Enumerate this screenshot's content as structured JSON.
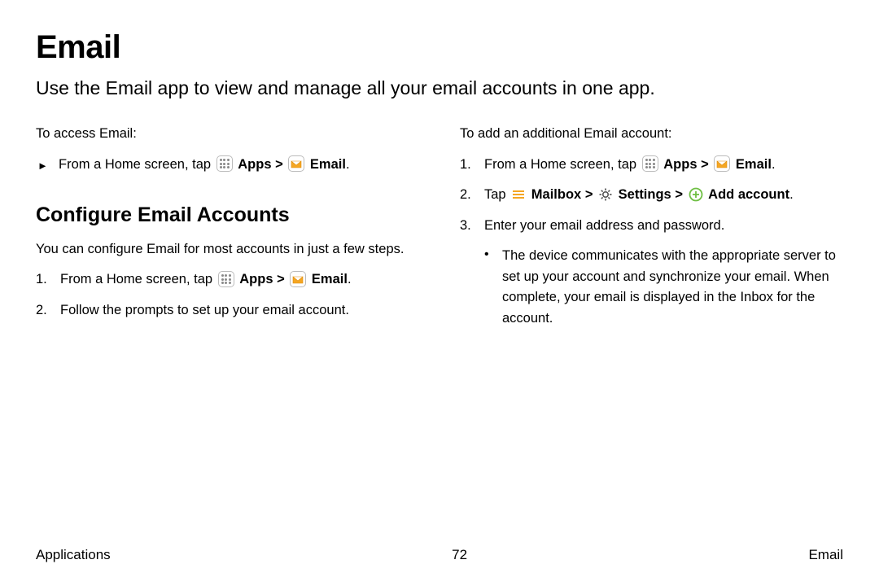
{
  "title": "Email",
  "intro": "Use the Email app to view and manage all your email accounts in one app.",
  "left": {
    "access_label": "To access Email:",
    "step1_prefix": "From a Home screen, tap ",
    "apps_label": "Apps",
    "chevron": ">",
    "email_label": "Email",
    "period": ".",
    "section_title": "Configure Email Accounts",
    "section_desc": "You can configure Email for most accounts in just a few steps.",
    "num1": "1.",
    "num2": "2.",
    "step_configure_1_prefix": "From a Home screen, tap ",
    "step_configure_2": "Follow the prompts to set up your email account."
  },
  "right": {
    "add_label": "To add an additional Email account:",
    "num1": "1.",
    "num2": "2.",
    "num3": "3.",
    "step1_prefix": "From a Home screen, tap ",
    "apps_label": "Apps",
    "chevron": ">",
    "email_label": "Email",
    "period": ".",
    "step2_prefix": "Tap ",
    "mailbox_label": "Mailbox",
    "settings_label": "Settings",
    "add_account_label": "Add account",
    "step3": "Enter your email address and password.",
    "bullet_text": "The device communicates with the appropriate server to set up your account and synchronize your email. When complete, your email is displayed in the Inbox for the account."
  },
  "footer": {
    "left": "Applications",
    "center": "72",
    "right": "Email"
  }
}
